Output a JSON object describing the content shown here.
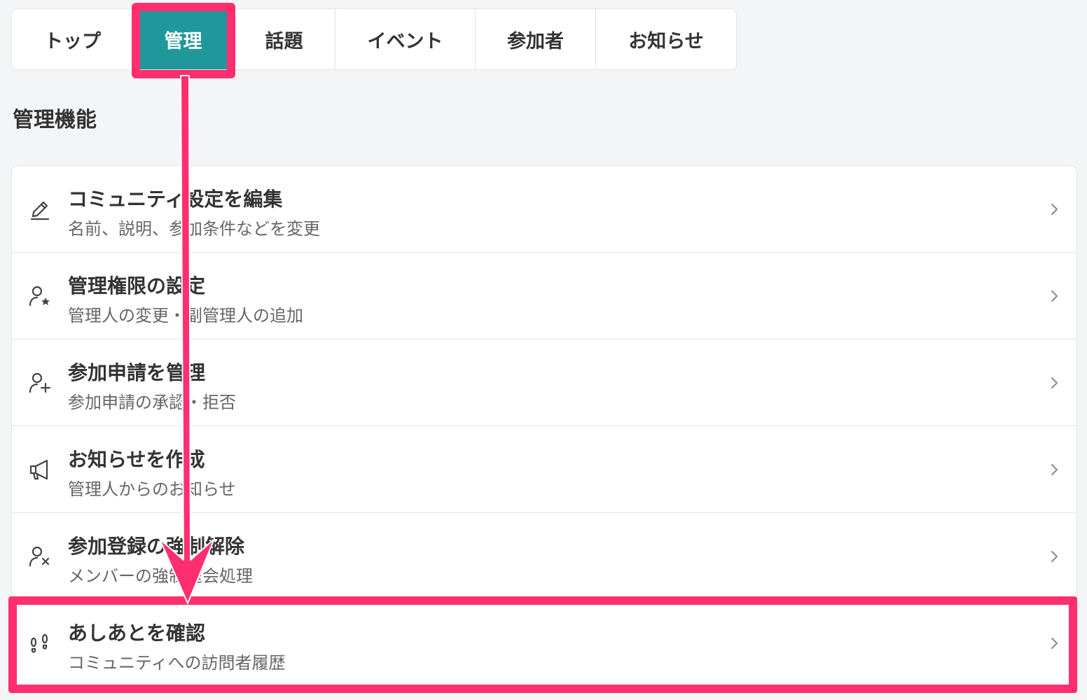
{
  "tabs": {
    "items": [
      {
        "label": "トップ",
        "width": 174
      },
      {
        "label": "管理",
        "width": 142,
        "active": true
      },
      {
        "label": "話題",
        "width": 146
      },
      {
        "label": "イベント",
        "width": 200
      },
      {
        "label": "参加者",
        "width": 172
      },
      {
        "label": "お知らせ",
        "width": 200
      }
    ]
  },
  "section": {
    "title": "管理機能"
  },
  "menu": {
    "items": [
      {
        "title": "コミュニティ設定を編集",
        "subtitle": "名前、説明、参加条件などを変更",
        "icon": "pencil-icon"
      },
      {
        "title": "管理権限の設定",
        "subtitle": "管理人の変更・副管理人の追加",
        "icon": "user-star-icon"
      },
      {
        "title": "参加申請を管理",
        "subtitle": "参加申請の承認・拒否",
        "icon": "user-plus-icon"
      },
      {
        "title": "お知らせを作成",
        "subtitle": "管理人からのお知らせ",
        "icon": "megaphone-icon"
      },
      {
        "title": "参加登録の強制解除",
        "subtitle": "メンバーの強制退会処理",
        "icon": "user-x-icon"
      },
      {
        "title": "あしあとを確認",
        "subtitle": "コミュニティへの訪問者履歴",
        "icon": "footprints-icon"
      }
    ]
  },
  "colors": {
    "accent": "#20979a",
    "highlight": "#ff2e6e"
  }
}
